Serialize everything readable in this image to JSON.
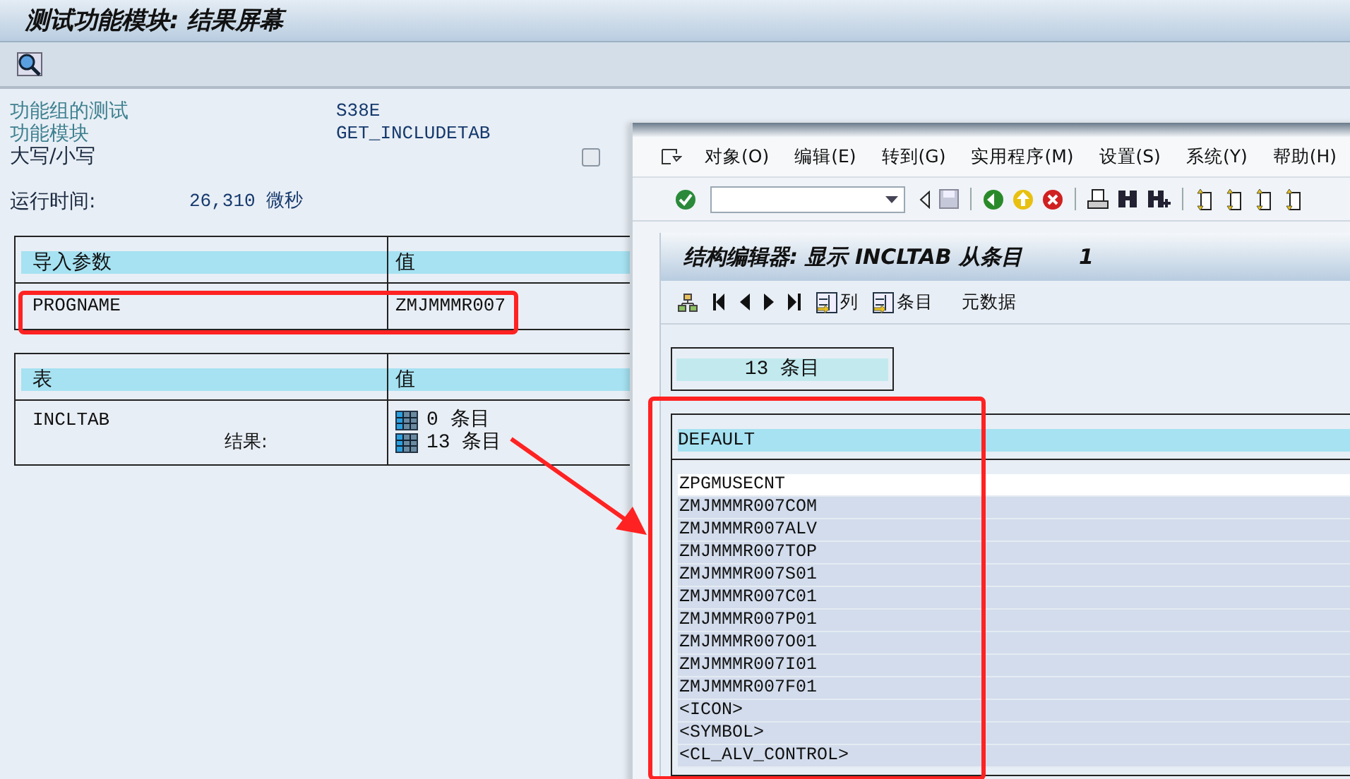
{
  "main_window": {
    "title": "测试功能模块: 结果屏幕",
    "fields": [
      {
        "label": "功能组的测试",
        "value": "S38E",
        "kind": "text"
      },
      {
        "label": "功能模块",
        "value": "GET_INCLUDETAB",
        "kind": "text"
      },
      {
        "label": "大写/小写",
        "checked": false,
        "kind": "checkbox"
      }
    ],
    "runtime": {
      "label": "运行时间:",
      "value": "26,310 微秒"
    },
    "import_table": {
      "columns": [
        "导入参数",
        "值"
      ],
      "rows": [
        {
          "name": "PROGNAME",
          "value": "ZMJMMMR007"
        }
      ]
    },
    "tables_table": {
      "columns": [
        "表",
        "值"
      ],
      "rows": [
        {
          "name": "INCLTAB",
          "result_label": "结果:",
          "entries": [
            "0 条目",
            "13 条目"
          ]
        }
      ]
    }
  },
  "popup": {
    "menu": [
      "对象(O)",
      "编辑(E)",
      "转到(G)",
      "实用程序(M)",
      "设置(S)",
      "系统(Y)",
      "帮助(H)"
    ],
    "title": "结构编辑器: 显示 INCLTAB 从条目",
    "title_number": "1",
    "app_toolbar": [
      {
        "kind": "tree"
      },
      {
        "kind": "first"
      },
      {
        "kind": "prev"
      },
      {
        "kind": "next"
      },
      {
        "kind": "last"
      },
      {
        "kind": "labeled",
        "label": "列"
      },
      {
        "kind": "labeled",
        "label": "条目"
      },
      {
        "kind": "text",
        "label": "元数据"
      }
    ],
    "count": "13 条目",
    "list": {
      "column": "DEFAULT",
      "rows": [
        {
          "text": "ZPGMUSECNT",
          "selected": true
        },
        {
          "text": "ZMJMMMR007COM",
          "selected": false
        },
        {
          "text": "ZMJMMMR007ALV",
          "selected": false
        },
        {
          "text": "ZMJMMMR007TOP",
          "selected": false
        },
        {
          "text": "ZMJMMMR007S01",
          "selected": false
        },
        {
          "text": "ZMJMMMR007C01",
          "selected": false
        },
        {
          "text": "ZMJMMMR007P01",
          "selected": false
        },
        {
          "text": "ZMJMMMR007O01",
          "selected": false
        },
        {
          "text": "ZMJMMMR007I01",
          "selected": false
        },
        {
          "text": "ZMJMMMR007F01",
          "selected": false
        },
        {
          "text": "<ICON>",
          "selected": false
        },
        {
          "text": "<SYMBOL>",
          "selected": false
        },
        {
          "text": "<CL_ALV_CONTROL>",
          "selected": false
        }
      ]
    }
  }
}
